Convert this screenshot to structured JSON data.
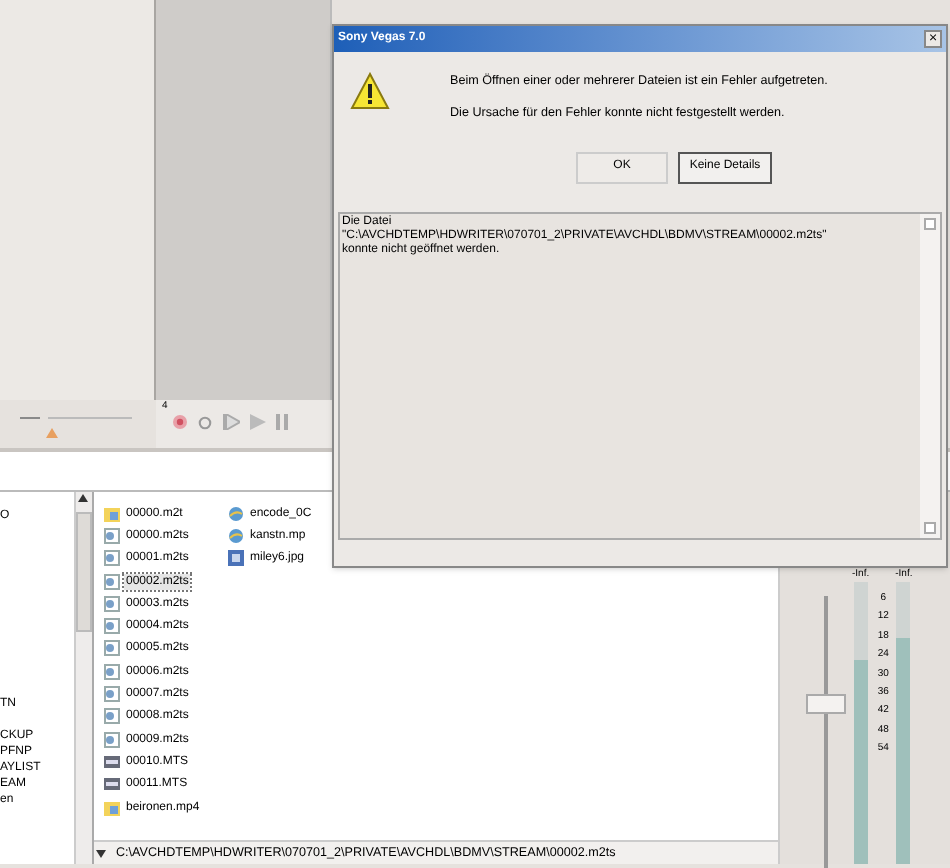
{
  "dialog": {
    "title": "Sony Vegas 7.0",
    "close": "×",
    "messages": [
      "Beim Öffnen einer oder mehrerer Dateien ist ein Fehler aufgetreten.",
      "Die Ursache für den Fehler konnte nicht festgestellt werden."
    ],
    "buttons": [
      {
        "label": "OK",
        "kind": "ok"
      },
      {
        "label": "Keine Details",
        "kind": "details"
      }
    ],
    "details": [
      "Die Datei",
      "\"C:\\AVCHDTEMP\\HDWRITER\\070701_2\\PRIVATE\\AVCHDL\\BDMV\\STREAM\\00002.m2ts\"",
      "konnte nicht geöffnet werden."
    ]
  },
  "timeline": {
    "marker": "4"
  },
  "tree": {
    "items": [
      "O",
      "TN",
      "CKUP",
      "PFNP",
      "AYLIST",
      "EAM",
      "en"
    ]
  },
  "files": {
    "columns": [
      [
        {
          "name": "00000.m2t",
          "kind": "media",
          "selected": false
        },
        {
          "name": "00000.m2ts",
          "kind": "clip",
          "selected": false
        },
        {
          "name": "00001.m2ts",
          "kind": "clip",
          "selected": false
        },
        {
          "name": "00002.m2ts",
          "kind": "clip",
          "selected": true
        },
        {
          "name": "00003.m2ts",
          "kind": "clip",
          "selected": false
        },
        {
          "name": "00004.m2ts",
          "kind": "clip",
          "selected": false
        },
        {
          "name": "00005.m2ts",
          "kind": "clip",
          "selected": false
        },
        {
          "name": "00006.m2ts",
          "kind": "clip",
          "selected": false
        },
        {
          "name": "00007.m2ts",
          "kind": "clip",
          "selected": false
        },
        {
          "name": "00008.m2ts",
          "kind": "clip",
          "selected": false
        },
        {
          "name": "00009.m2ts",
          "kind": "clip",
          "selected": false
        },
        {
          "name": "00010.MTS",
          "kind": "mts",
          "selected": false
        },
        {
          "name": "00011.MTS",
          "kind": "mts",
          "selected": false
        },
        {
          "name": "beironen.mp4",
          "kind": "media",
          "selected": false
        }
      ],
      [
        {
          "name": "encode_0C",
          "kind": "web",
          "selected": false
        },
        {
          "name": "kanstn.mp",
          "kind": "web",
          "selected": false
        },
        {
          "name": "miley6.jpg",
          "kind": "image",
          "selected": false
        }
      ]
    ]
  },
  "path": "C:\\AVCHDTEMP\\HDWRITER\\070701_2\\PRIVATE\\AVCHDL\\BDMV\\STREAM\\00002.m2ts",
  "mixer": {
    "fader": {
      "level": 0.62
    },
    "channels": [
      {
        "label": "-Inf.",
        "level": 0.72
      },
      {
        "label": "-Inf.",
        "level": 0.8
      }
    ],
    "scale": [
      "6",
      "12",
      "18",
      "24",
      "30",
      "36",
      "42",
      "48",
      "54"
    ]
  }
}
